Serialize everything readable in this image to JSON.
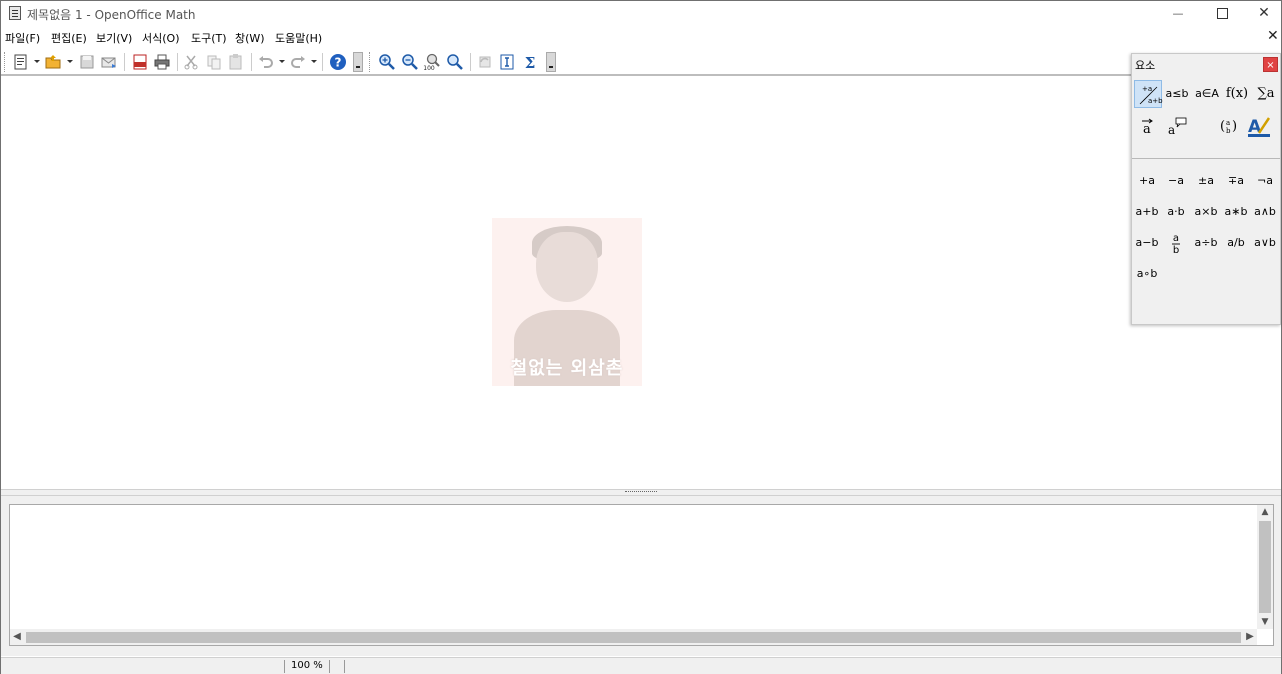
{
  "window": {
    "title": "제목없음 1 - OpenOffice Math",
    "minimize_label": "—",
    "close_label": "✕",
    "doc_close_label": "✕"
  },
  "menu": [
    {
      "label": "파일(F)"
    },
    {
      "label": "편집(E)"
    },
    {
      "label": "보기(V)"
    },
    {
      "label": "서식(O)"
    },
    {
      "label": "도구(T)"
    },
    {
      "label": "창(W)"
    },
    {
      "label": "도움말(H)"
    }
  ],
  "toolbar": {
    "icons": [
      "new-document-icon",
      "open-folder-icon",
      "save-icon",
      "send-mail-icon",
      "export-pdf-icon",
      "print-icon",
      "cut-icon",
      "copy-icon",
      "paste-icon",
      "undo-icon",
      "redo-icon",
      "help-icon",
      "zoom-in-icon",
      "zoom-out-icon",
      "zoom-100-icon",
      "show-all-icon",
      "update-icon",
      "formula-cursor-icon",
      "symbols-icon"
    ]
  },
  "watermark": {
    "text": "철없는 외삼촌"
  },
  "elements_panel": {
    "title": "요소",
    "close_label": "×",
    "categories": [
      {
        "label": "+a/a+b",
        "selected": true
      },
      {
        "label": "a≤b"
      },
      {
        "label": "a∈A"
      },
      {
        "label": "f(x)"
      },
      {
        "label": "∑a"
      },
      {
        "label": "a⃗"
      },
      {
        "label": "a💬"
      },
      {
        "label": "(a b)"
      },
      {
        "label": "A✎"
      }
    ],
    "operators": [
      "+a",
      "−a",
      "±a",
      "∓a",
      "¬a",
      "a+b",
      "a·b",
      "a×b",
      "a∗b",
      "a∧b",
      "a−b",
      "a/b frac",
      "a÷b",
      "a/b",
      "a∨b",
      "a∘b"
    ]
  },
  "status": {
    "zoom": "100 %"
  },
  "colors": {
    "accent_selected": "#cfe3f7",
    "close_red": "#e04343",
    "help_blue": "#1f5fbf"
  }
}
